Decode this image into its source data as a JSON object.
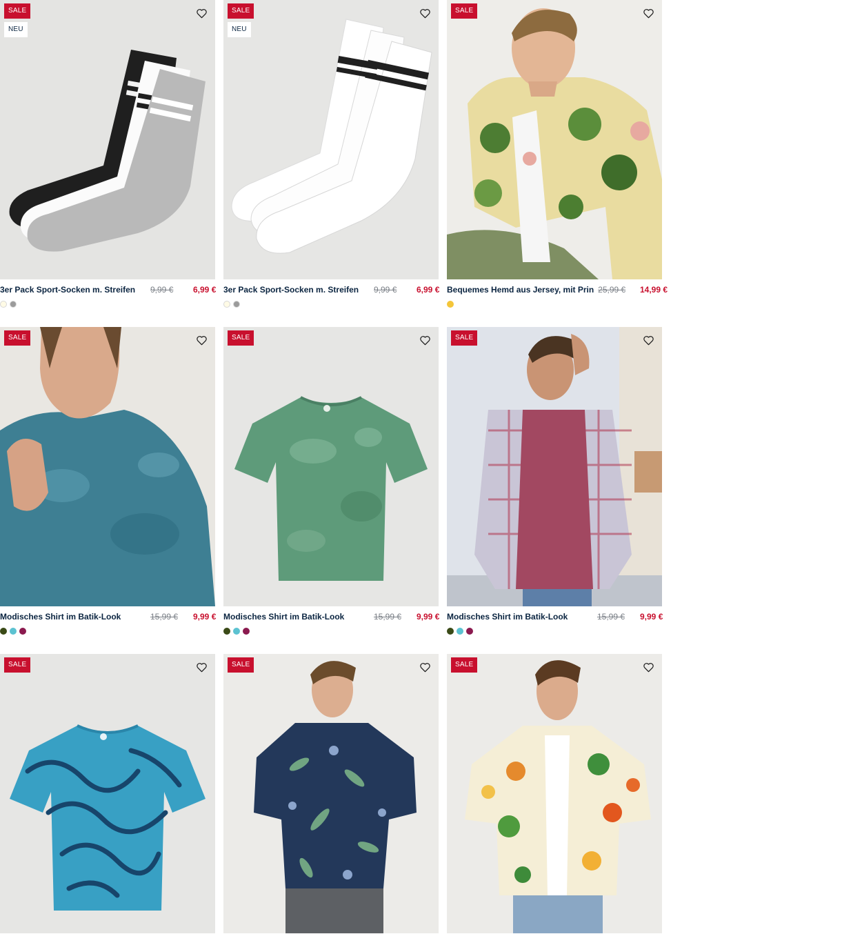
{
  "colors": {
    "sale": "#c8102e",
    "text": "#0a2440",
    "old_price": "#7a7f86"
  },
  "products": [
    {
      "badges": [
        "SALE",
        "NEU"
      ],
      "name": "3er Pack Sport-Socken m. Streifen",
      "old_price": "9,99 €",
      "price": "6,99 €",
      "swatches": [
        "#fffbe6",
        "#9b9b9b"
      ],
      "wishlist_icon": "heart-outline-icon"
    },
    {
      "badges": [
        "SALE",
        "NEU"
      ],
      "name": "3er Pack Sport-Socken m. Streifen",
      "old_price": "9,99 €",
      "price": "6,99 €",
      "swatches": [
        "#fffbe6",
        "#9b9b9b"
      ],
      "wishlist_icon": "heart-outline-icon"
    },
    {
      "badges": [
        "SALE"
      ],
      "name": "Bequemes Hemd aus Jersey, mit Print",
      "old_price": "25,99 €",
      "price": "14,99 €",
      "swatches": [
        "#f4c63a"
      ],
      "wishlist_icon": "heart-outline-icon"
    },
    {
      "badges": [
        "SALE"
      ],
      "name": "Modisches Shirt im Batik-Look",
      "old_price": "15,99 €",
      "price": "9,99 €",
      "swatches": [
        "#3a4a17",
        "#5cc2d1",
        "#8b1a4f"
      ],
      "wishlist_icon": "heart-outline-icon"
    },
    {
      "badges": [
        "SALE"
      ],
      "name": "Modisches Shirt im Batik-Look",
      "old_price": "15,99 €",
      "price": "9,99 €",
      "swatches": [
        "#3a4a17",
        "#5cc2d1",
        "#8b1a4f"
      ],
      "wishlist_icon": "heart-outline-icon"
    },
    {
      "badges": [
        "SALE"
      ],
      "name": "Modisches Shirt im Batik-Look",
      "old_price": "15,99 €",
      "price": "9,99 €",
      "swatches": [
        "#3a4a17",
        "#5cc2d1",
        "#8b1a4f"
      ],
      "wishlist_icon": "heart-outline-icon"
    },
    {
      "badges": [
        "SALE"
      ],
      "wishlist_icon": "heart-outline-icon"
    },
    {
      "badges": [
        "SALE"
      ],
      "wishlist_icon": "heart-outline-icon"
    },
    {
      "badges": [
        "SALE"
      ],
      "wishlist_icon": "heart-outline-icon"
    }
  ]
}
